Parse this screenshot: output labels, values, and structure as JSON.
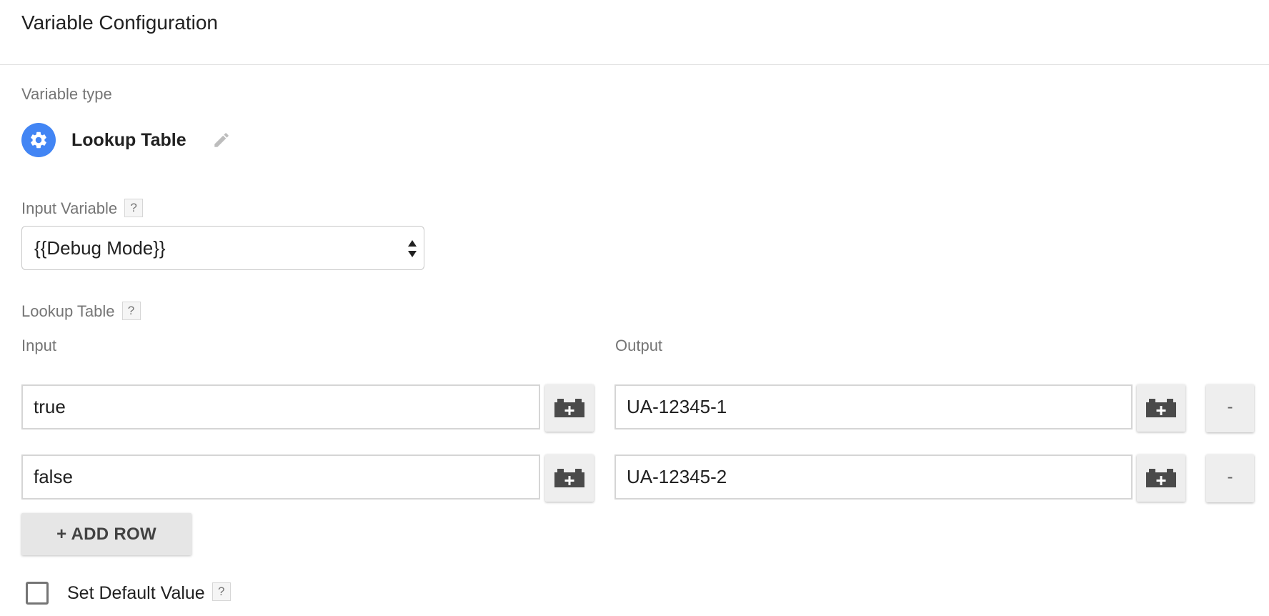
{
  "header": {
    "title": "Variable Configuration"
  },
  "variable_type": {
    "label": "Variable type",
    "name": "Lookup Table",
    "icon": "gear-icon",
    "icon_bg": "#4285f4"
  },
  "input_variable": {
    "label": "Input Variable",
    "help": "?",
    "value": "{{Debug Mode}}"
  },
  "lookup_table": {
    "label": "Lookup Table",
    "help": "?",
    "input_header": "Input",
    "output_header": "Output",
    "rows": [
      {
        "input": "true",
        "output": "UA-12345-1",
        "remove": "-"
      },
      {
        "input": "false",
        "output": "UA-12345-2",
        "remove": "-"
      }
    ],
    "add_row_label": "+ ADD ROW"
  },
  "default_value": {
    "label": "Set Default Value",
    "checked": false,
    "help": "?"
  }
}
